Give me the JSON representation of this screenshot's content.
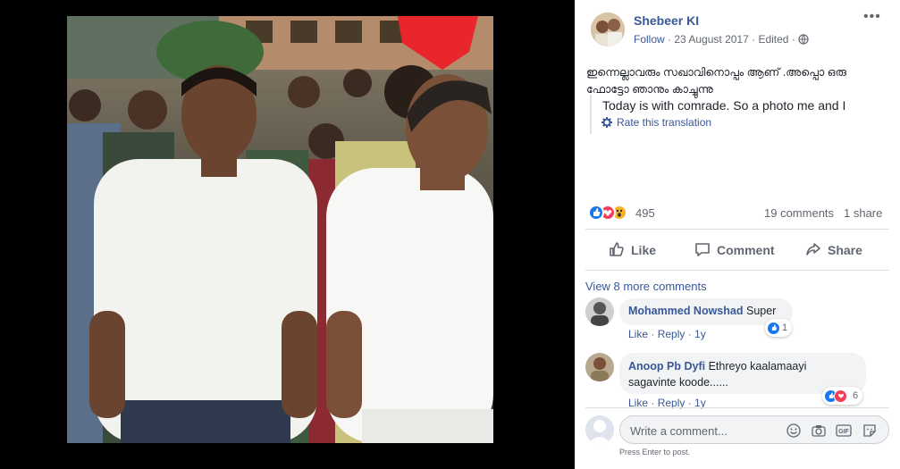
{
  "post": {
    "author": "Shebeer KI",
    "follow": "Follow",
    "separator1": " · ",
    "date": "23 August 2017",
    "separator2": " · ",
    "edited": "Edited",
    "separator3": " · ",
    "text_line1": "ഇന്നെല്ലാവരും സഖാവിനൊപ്പം ആണ് .അപ്പൊ ഒരു",
    "text_line2": "ഫോട്ടോ ഞാനും കാച്ചുന്നു",
    "translation": "Today is with comrade. So a photo me and I",
    "rate_translation": "Rate this translation",
    "reaction_count": "495",
    "comment_count": "19 comments",
    "share_count": "1 share"
  },
  "actions": {
    "like": "Like",
    "comment": "Comment",
    "share": "Share"
  },
  "comments": {
    "view_more": "View 8 more comments",
    "items": [
      {
        "author": "Mohammed Nowshad",
        "text": "Super",
        "like": "Like",
        "dot": " · ",
        "reply": "Reply",
        "dot2": " · ",
        "time": "1y",
        "reactions": "1"
      },
      {
        "author": "Anoop Pb Dyfi",
        "text_line1": "Ethreyo kaalamaayi",
        "text_line2": "sagavinte koode......",
        "like": "Like",
        "dot": " · ",
        "reply": "Reply",
        "dot2": " · ",
        "time": "1y",
        "reactions": "6"
      }
    ]
  },
  "composer": {
    "placeholder": "Write a comment...",
    "hint": "Press Enter to post."
  },
  "colors": {
    "link": "#385898",
    "like_blue": "#1877f2",
    "love_red": "#f33e58",
    "wow_yellow": "#f7b125"
  }
}
